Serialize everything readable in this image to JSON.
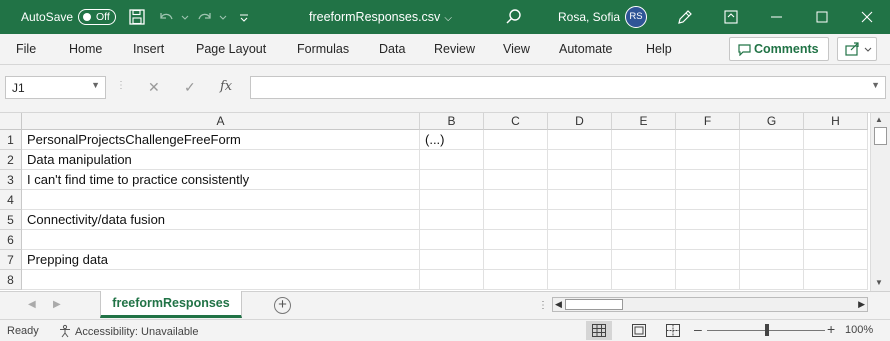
{
  "titlebar": {
    "autosave_label": "AutoSave",
    "autosave_state": "Off",
    "file_name": "freeformResponses.csv",
    "user_name": "Rosa, Sofia",
    "user_initials": "RS"
  },
  "menu": [
    "File",
    "Home",
    "Insert",
    "Page Layout",
    "Formulas",
    "Data",
    "Review",
    "View",
    "Automate",
    "Help"
  ],
  "comments_label": "Comments",
  "formula_bar": {
    "name_box": "J1",
    "fx_label": "fx",
    "formula": ""
  },
  "grid": {
    "columns": [
      "A",
      "B",
      "C",
      "D",
      "E",
      "F",
      "G",
      "H"
    ],
    "rows": [
      "1",
      "2",
      "3",
      "4",
      "5",
      "6",
      "7",
      "8"
    ],
    "cells": [
      [
        "PersonalProjectsChallengeFreeForm",
        "(...)",
        "",
        "",
        "",
        "",
        "",
        ""
      ],
      [
        "Data manipulation",
        "",
        "",
        "",
        "",
        "",
        "",
        ""
      ],
      [
        "I can't find time to practice consistently",
        "",
        "",
        "",
        "",
        "",
        "",
        ""
      ],
      [
        "",
        "",
        "",
        "",
        "",
        "",
        "",
        ""
      ],
      [
        "Connectivity/data fusion",
        "",
        "",
        "",
        "",
        "",
        "",
        ""
      ],
      [
        "",
        "",
        "",
        "",
        "",
        "",
        "",
        ""
      ],
      [
        "Prepping data",
        "",
        "",
        "",
        "",
        "",
        "",
        ""
      ],
      [
        "",
        "",
        "",
        "",
        "",
        "",
        "",
        ""
      ]
    ]
  },
  "sheet_tab": "freeformResponses",
  "status": {
    "ready": "Ready",
    "accessibility": "Accessibility: Unavailable",
    "zoom": "100%"
  },
  "colors": {
    "accent": "#217346",
    "avatar": "#2f5597"
  }
}
